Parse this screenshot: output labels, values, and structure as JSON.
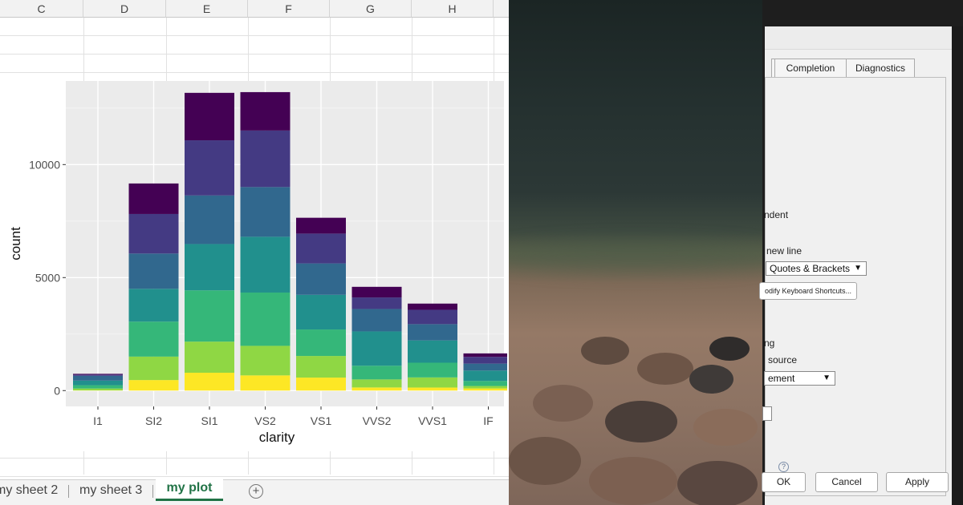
{
  "spreadsheet": {
    "columns": [
      "C",
      "D",
      "E",
      "F",
      "G",
      "H"
    ],
    "tabs": [
      {
        "label": "my sheet 2",
        "active": false
      },
      {
        "label": "my sheet 3",
        "active": false
      },
      {
        "label": "my plot",
        "active": true
      }
    ],
    "add_sheet_icon": "plus-circle-icon",
    "active_tab_color": "#217346"
  },
  "chart_data": {
    "type": "bar",
    "stacked": true,
    "xlabel": "clarity",
    "ylabel": "count",
    "categories": [
      "I1",
      "SI2",
      "SI1",
      "VS2",
      "VS1",
      "VVS2",
      "VVS1",
      "IF"
    ],
    "yticks": [
      0,
      5000,
      10000
    ],
    "ylim": [
      -700,
      13700
    ],
    "grid": true,
    "legend": "none",
    "series": [
      {
        "color": "#fde725",
        "values": [
          8,
          466,
          790,
          672,
          575,
          138,
          135,
          95
        ]
      },
      {
        "color": "#8fd744",
        "values": [
          84,
          1038,
          1376,
          1308,
          957,
          356,
          448,
          107
        ]
      },
      {
        "color": "#35b779",
        "values": [
          146,
          1547,
          2268,
          2357,
          1171,
          606,
          650,
          224
        ]
      },
      {
        "color": "#21908d",
        "values": [
          204,
          1453,
          2050,
          2469,
          1534,
          1518,
          987,
          460
        ]
      },
      {
        "color": "#31688e",
        "values": [
          212,
          1560,
          2150,
          2200,
          1390,
          993,
          720,
          306
        ]
      },
      {
        "color": "#443a83",
        "values": [
          52,
          1750,
          2440,
          2500,
          1320,
          510,
          635,
          300
        ]
      },
      {
        "color": "#440154",
        "values": [
          35,
          1350,
          2100,
          1700,
          700,
          470,
          274,
          153
        ]
      }
    ]
  },
  "dialog": {
    "tabs": [
      "Completion",
      "Diagnostics"
    ],
    "lines": {
      "indent": "ndent",
      "new_line": "new line",
      "ng": "ng",
      "source": "source"
    },
    "select_quotes": "Quotes & Brackets",
    "select_statement": "ement",
    "shortcuts_button": "odify Keyboard Shortcuts...",
    "help_icon": "question-circle-icon",
    "buttons": {
      "ok": "OK",
      "cancel": "Cancel",
      "apply": "Apply"
    }
  }
}
